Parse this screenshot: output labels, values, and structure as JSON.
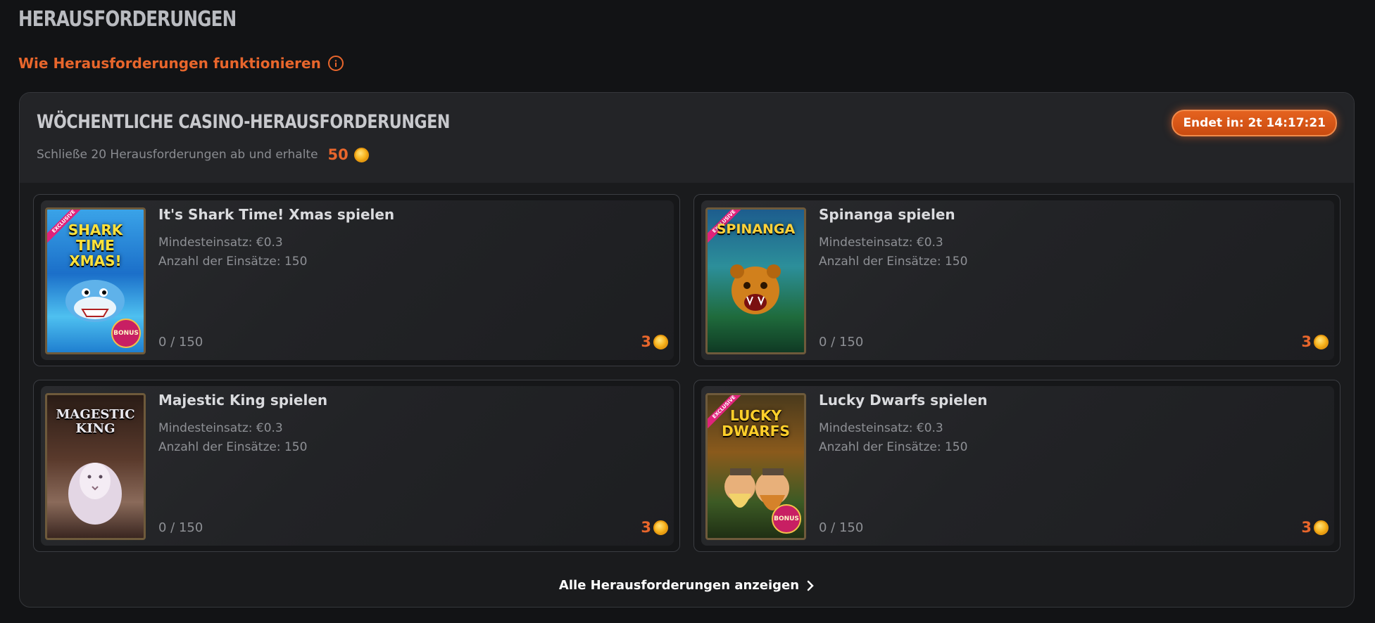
{
  "page": {
    "title": "Herausforderungen",
    "how_it_works": "Wie Herausforderungen funktionieren"
  },
  "panel": {
    "title": "Wöchentliche Casino-Herausforderungen",
    "subtitle": "Schließe 20 Herausforderungen ab und erhalte",
    "total_reward": "50",
    "timer": "Endet in: 2t 14:17:21",
    "footer_link": "Alle Herausforderungen anzeigen"
  },
  "challenges": [
    {
      "title": "It's Shark Time! Xmas spielen",
      "thumb_text": "SHARK TIME XMAS!",
      "exclusive": "EXCLUSIVE",
      "bonus": "BONUS",
      "min_bet": "Mindesteinsatz: €0.3",
      "bet_count": "Anzahl der Einsätze: 150",
      "progress": "0 / 150",
      "reward": "3"
    },
    {
      "title": "Spinanga spielen",
      "thumb_text": "SPINANGA",
      "exclusive": "EXCLUSIVE",
      "bonus": "",
      "min_bet": "Mindesteinsatz: €0.3",
      "bet_count": "Anzahl der Einsätze: 150",
      "progress": "0 / 150",
      "reward": "3"
    },
    {
      "title": "Majestic King spielen",
      "thumb_text": "MAGESTIC KING",
      "exclusive": "",
      "bonus": "",
      "min_bet": "Mindesteinsatz: €0.3",
      "bet_count": "Anzahl der Einsätze: 150",
      "progress": "0 / 150",
      "reward": "3"
    },
    {
      "title": "Lucky Dwarfs spielen",
      "thumb_text": "LUCKY DWARFS",
      "exclusive": "EXCLUSIVE",
      "bonus": "BONUS",
      "min_bet": "Mindesteinsatz: €0.3",
      "bet_count": "Anzahl der Einsätze: 150",
      "progress": "0 / 150",
      "reward": "3"
    }
  ],
  "colors": {
    "accent": "#e8662c",
    "background": "#121315"
  }
}
